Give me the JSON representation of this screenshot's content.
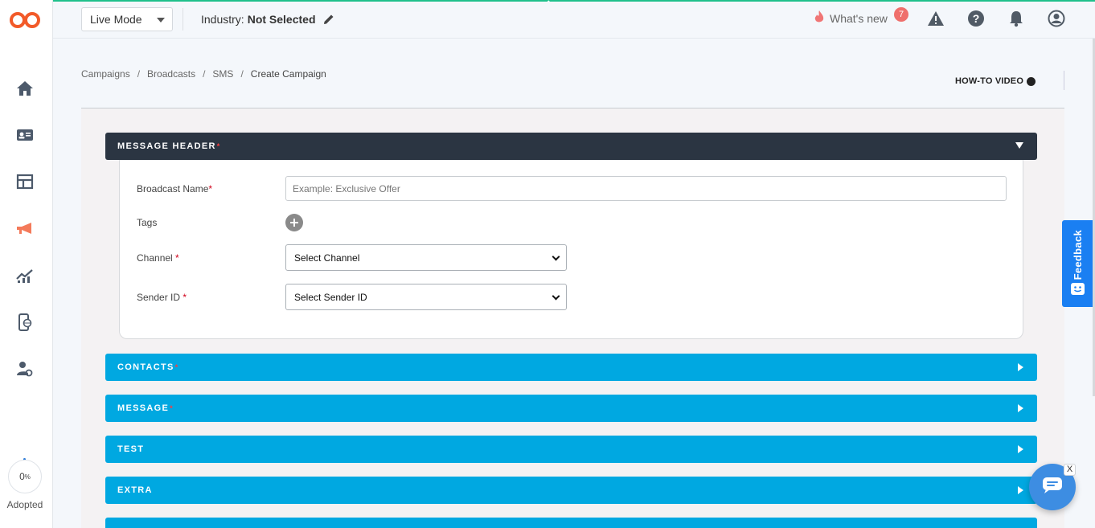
{
  "app": {
    "accent_color": "#1fc08b",
    "brand_color": "#f25a29"
  },
  "header": {
    "mode_value": "Live Mode",
    "industry_label": "Industry:",
    "industry_value": "Not Selected",
    "whats_new_label": "What's new",
    "whats_new_count": "7"
  },
  "sidebar": {
    "items": [
      "home-icon",
      "contact-card-icon",
      "layout-icon",
      "megaphone-icon",
      "analytics-icon",
      "mobile-web-icon",
      "user-settings-icon"
    ],
    "adopted_value": "0",
    "adopted_unit": "%",
    "adopted_label": "Adopted"
  },
  "breadcrumb": [
    "Campaigns",
    "Broadcasts",
    "SMS",
    "Create Campaign"
  ],
  "breadcrumb_sep": "/",
  "howto_label": "HOW-TO VIDEO",
  "sections": {
    "message_header": "MESSAGE HEADER",
    "contacts": "CONTACTS",
    "message": "MESSAGE",
    "test": "TEST",
    "extra": "EXTRA",
    "required_mark": "*"
  },
  "form": {
    "broadcast_name_label": "Broadcast Name",
    "broadcast_name_placeholder": "Example: Exclusive Offer",
    "tags_label": "Tags",
    "channel_label": "Channel ",
    "channel_value": "Select Channel",
    "sender_label": "Sender ID ",
    "sender_value": "Select Sender ID",
    "required_mark": "*"
  },
  "feedback_label": "Feedback",
  "chat_close": "X"
}
